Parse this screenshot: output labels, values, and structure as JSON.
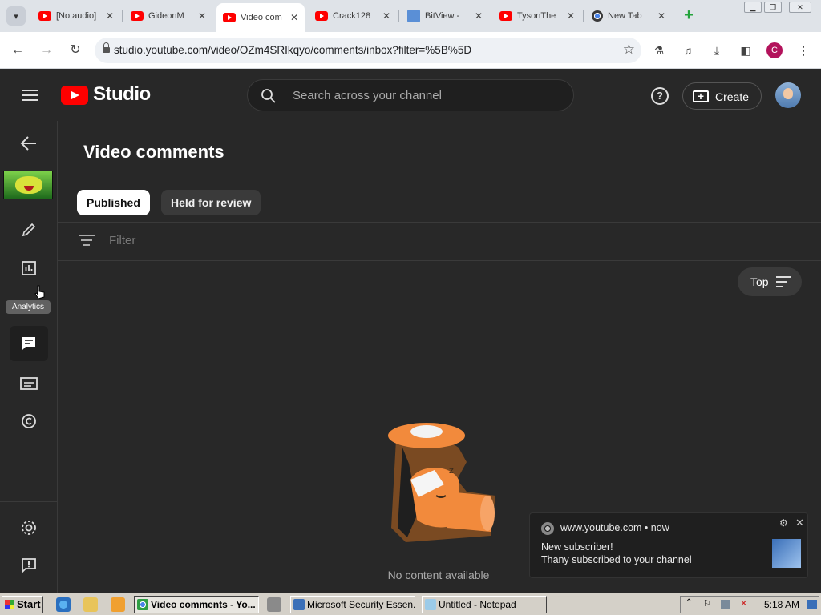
{
  "browser": {
    "tabs": [
      {
        "label": "[No audio]",
        "icon": "youtube-icon",
        "active": false
      },
      {
        "label": "GideonM",
        "icon": "youtube-icon",
        "active": false
      },
      {
        "label": "Video com",
        "icon": "youtube-icon",
        "active": true
      },
      {
        "label": "Crack128",
        "icon": "youtube-icon",
        "active": false
      },
      {
        "label": "BitView -",
        "icon": "bitview-icon",
        "active": false
      },
      {
        "label": "TysonThe",
        "icon": "youtube-icon",
        "active": false
      },
      {
        "label": "New Tab",
        "icon": "chrome-icon",
        "active": false
      }
    ],
    "tab_close": "✕",
    "new_tab": "+",
    "url": "studio.youtube.com/video/OZm4SRIkqyo/comments/inbox?filter=%5B%5D",
    "profile_initial": "C"
  },
  "studio": {
    "logo_text": "Studio",
    "search_placeholder": "Search across your channel",
    "help_glyph": "?",
    "create_label": "Create",
    "page_title": "Video comments",
    "tabs": {
      "published": "Published",
      "held": "Held for review"
    },
    "filter_placeholder": "Filter",
    "sort_label": "Top",
    "tooltip": "Analytics",
    "empty_text": "No content available",
    "colors": {
      "brand_red": "#ff0000",
      "background": "#282828"
    }
  },
  "notification": {
    "host": "www.youtube.com",
    "time": "now",
    "separator": "•",
    "title": "New subscriber!",
    "body": "Thany subscribed to your channel"
  },
  "taskbar": {
    "start_label": "Start",
    "windows": [
      {
        "label": "Video comments - Yo...",
        "pressed": true
      },
      {
        "label": "Microsoft Security Essen...",
        "pressed": false
      },
      {
        "label": "Untitled - Notepad",
        "pressed": false
      }
    ],
    "clock": "5:18 AM"
  }
}
